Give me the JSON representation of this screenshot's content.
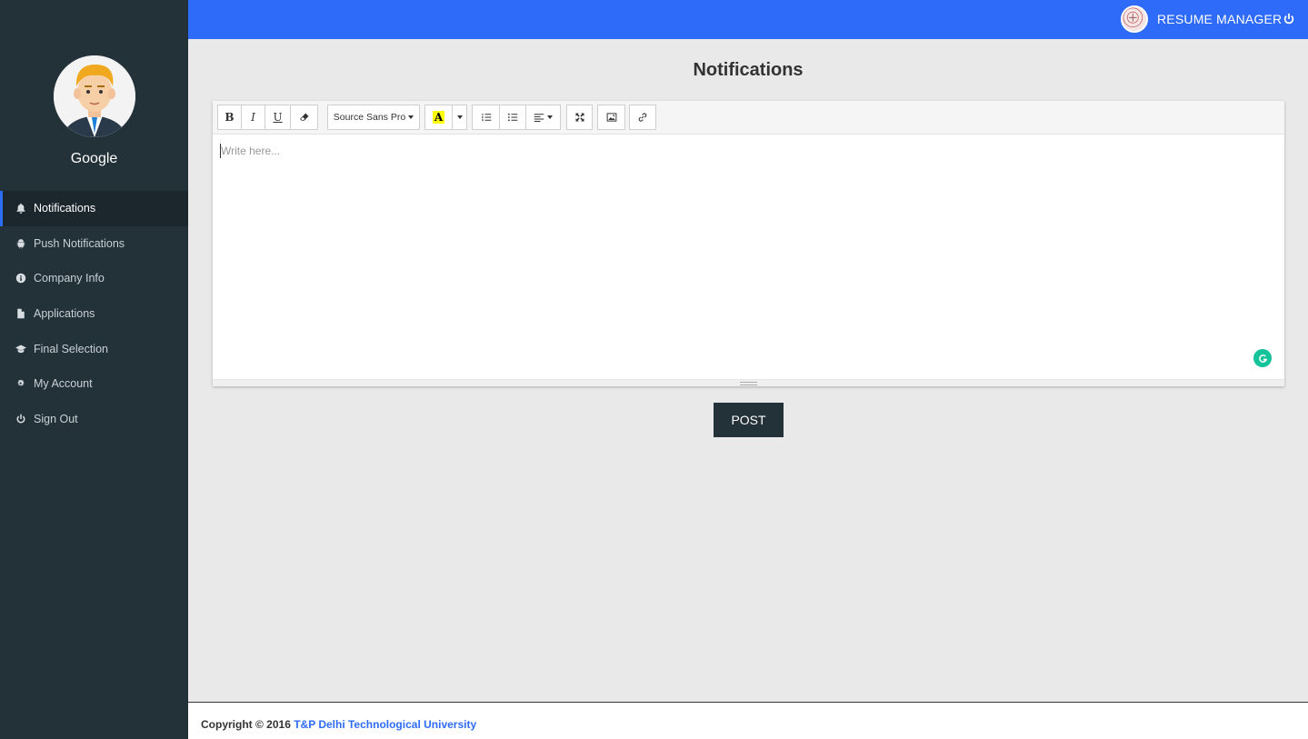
{
  "app": {
    "brand_title": "RESUME MANAGER"
  },
  "colors": {
    "sidebar": "#233139",
    "topbar": "#2e6bf8",
    "accent": "#2d6cf6",
    "post_button": "#233139"
  },
  "profile": {
    "name": "Google"
  },
  "sidebar": {
    "items": [
      {
        "label": "Notifications",
        "icon": "bell-icon",
        "active": true
      },
      {
        "label": "Push Notifications",
        "icon": "android-icon",
        "active": false
      },
      {
        "label": "Company Info",
        "icon": "info-circle-icon",
        "active": false
      },
      {
        "label": "Applications",
        "icon": "file-icon",
        "active": false
      },
      {
        "label": "Final Selection",
        "icon": "graduation-cap-icon",
        "active": false
      },
      {
        "label": "My Account",
        "icon": "cogs-icon",
        "active": false
      },
      {
        "label": "Sign Out",
        "icon": "power-icon",
        "active": false
      }
    ]
  },
  "main": {
    "title": "Notifications",
    "editor": {
      "placeholder": "Write here...",
      "toolbar": {
        "bold": "B",
        "italic": "I",
        "underline": "U",
        "font_name": "Source Sans Pro",
        "highlight": "A"
      }
    },
    "post_label": "POST"
  },
  "footer": {
    "copyright": "Copyright © 2016 ",
    "link_text": "T&P Delhi Technological University"
  }
}
